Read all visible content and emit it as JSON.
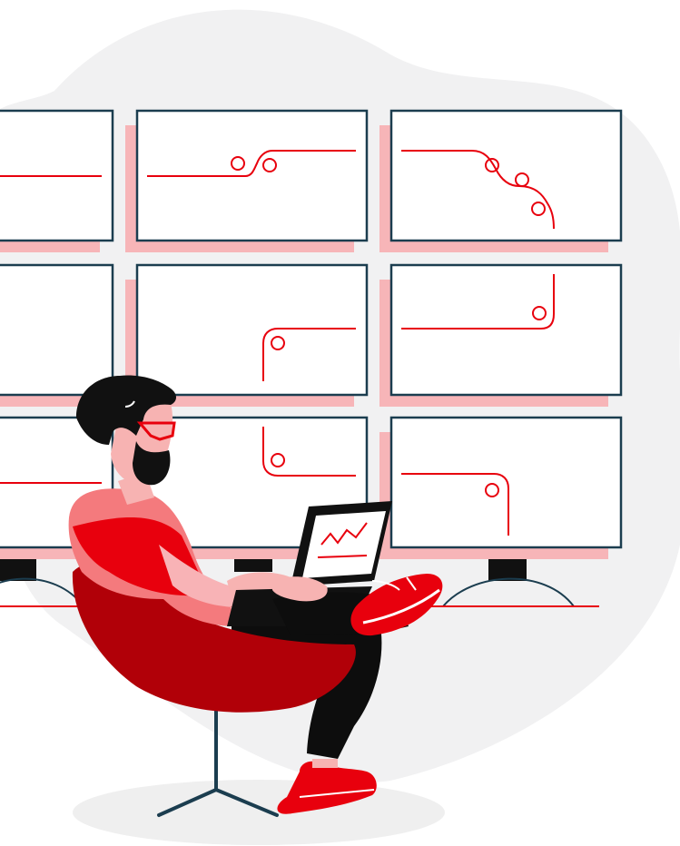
{
  "illustration": {
    "subject": "man-with-laptop-monitoring-screens",
    "screens_grid": {
      "rows": 3,
      "columns": 3
    },
    "laptop_screen_graph": "line-chart-rising",
    "colors": {
      "background": "#ffffff",
      "blob": "#f1f1f2",
      "monitor_border": "#1b3d4f",
      "monitor_fill": "#ffffff",
      "monitor_shadow": "#f7b5b8",
      "accent_red": "#e8000d",
      "dark_red": "#b10008",
      "light_pink": "#f8b3b6",
      "salmon": "#f47a7d",
      "skin": "#f7b3b2",
      "hair": "#111111",
      "laptop": "#111111",
      "pants": "#0d0d0d",
      "floor_shadow": "#efefef",
      "chair_leg": "#1b3d4f"
    }
  }
}
